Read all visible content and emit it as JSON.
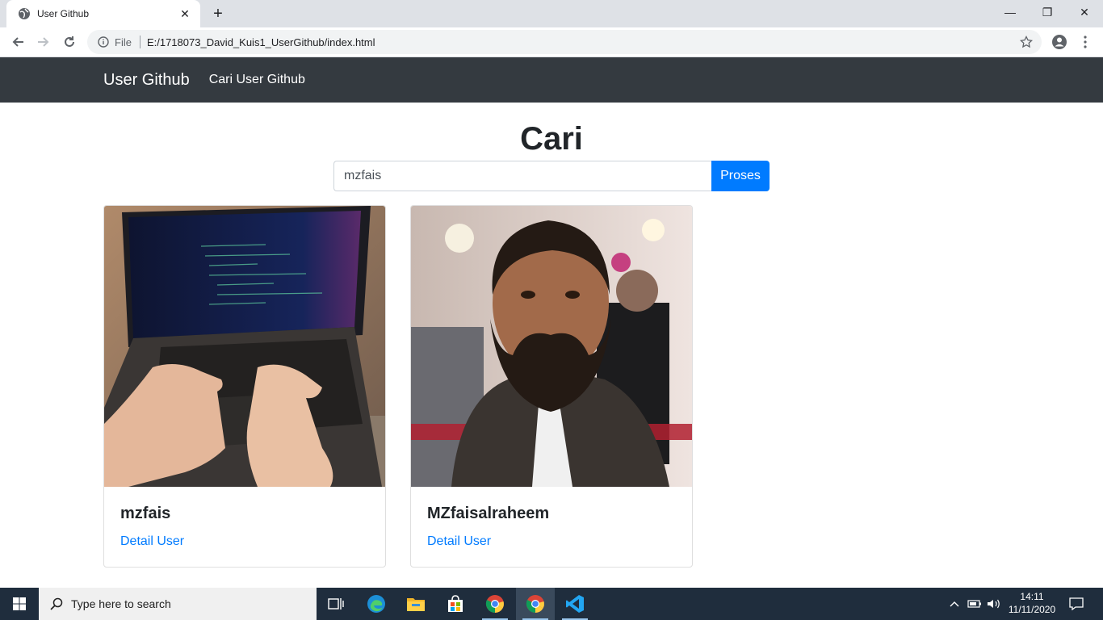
{
  "browser": {
    "tab_title": "User Github",
    "close_glyph": "✕",
    "newtab_glyph": "+",
    "omnibox_scheme": "File",
    "omnibox_url": "E:/1718073_David_Kuis1_UserGithub/index.html",
    "window_minimize": "—",
    "window_restore": "❐",
    "window_close": "✕"
  },
  "navbar": {
    "brand": "User Github",
    "link": "Cari User Github"
  },
  "main": {
    "heading": "Cari",
    "search_value": "mzfais",
    "search_button": "Proses"
  },
  "cards": [
    {
      "title": "mzfais",
      "link": "Detail User"
    },
    {
      "title": "MZfaisalraheem",
      "link": "Detail User"
    }
  ],
  "taskbar": {
    "search_placeholder": "Type here to search",
    "time": "14:11",
    "date": "11/11/2020"
  }
}
